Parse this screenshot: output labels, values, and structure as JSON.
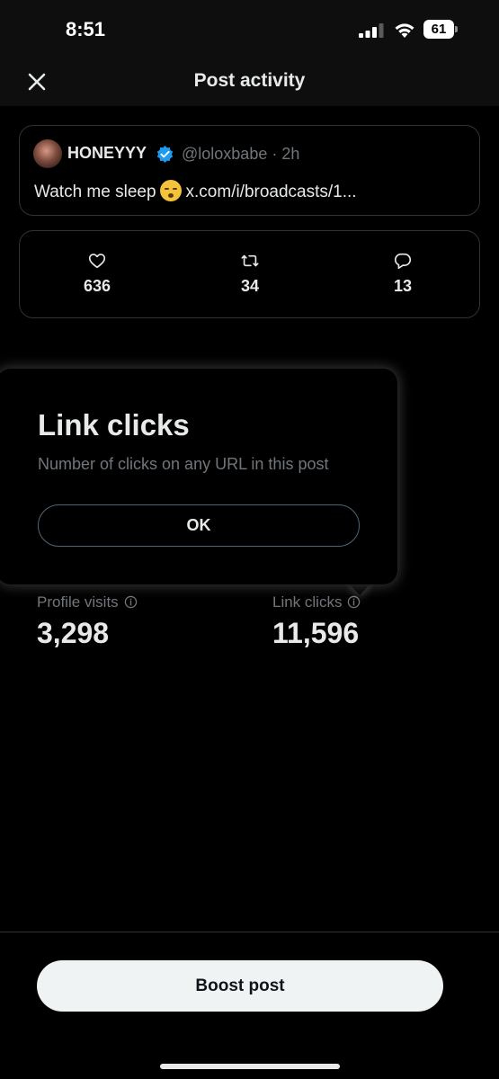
{
  "status_bar": {
    "time": "8:51",
    "battery": "61",
    "icons": [
      "signal-icon",
      "wifi-icon",
      "battery-icon"
    ]
  },
  "header": {
    "title": "Post activity",
    "close_icon": "close-icon"
  },
  "post": {
    "author": "HONEYYY",
    "verified": true,
    "handle": "@loloxbabe",
    "separator": "·",
    "age": "2h",
    "text_before": "Watch me sleep",
    "link": "x.com/i/broadcasts/1..."
  },
  "engagement": {
    "likes": "636",
    "reposts": "34",
    "replies": "13",
    "icons": [
      "heart-icon",
      "repost-icon",
      "reply-icon"
    ]
  },
  "metrics": {
    "profile_visits_label": "Profile visits",
    "profile_visits": "3,298",
    "link_clicks_label": "Link clicks",
    "link_clicks": "11,596"
  },
  "popover": {
    "title": "Link clicks",
    "description": "Number of clicks on any URL in this post",
    "ok_label": "OK"
  },
  "footer": {
    "boost_label": "Boost post"
  },
  "colors": {
    "background": "#000000",
    "text_primary": "#e7e9ea",
    "text_secondary": "#71767b",
    "border": "#2f3336",
    "verified_blue": "#1d9bf0",
    "button_light": "#eff3f4"
  }
}
